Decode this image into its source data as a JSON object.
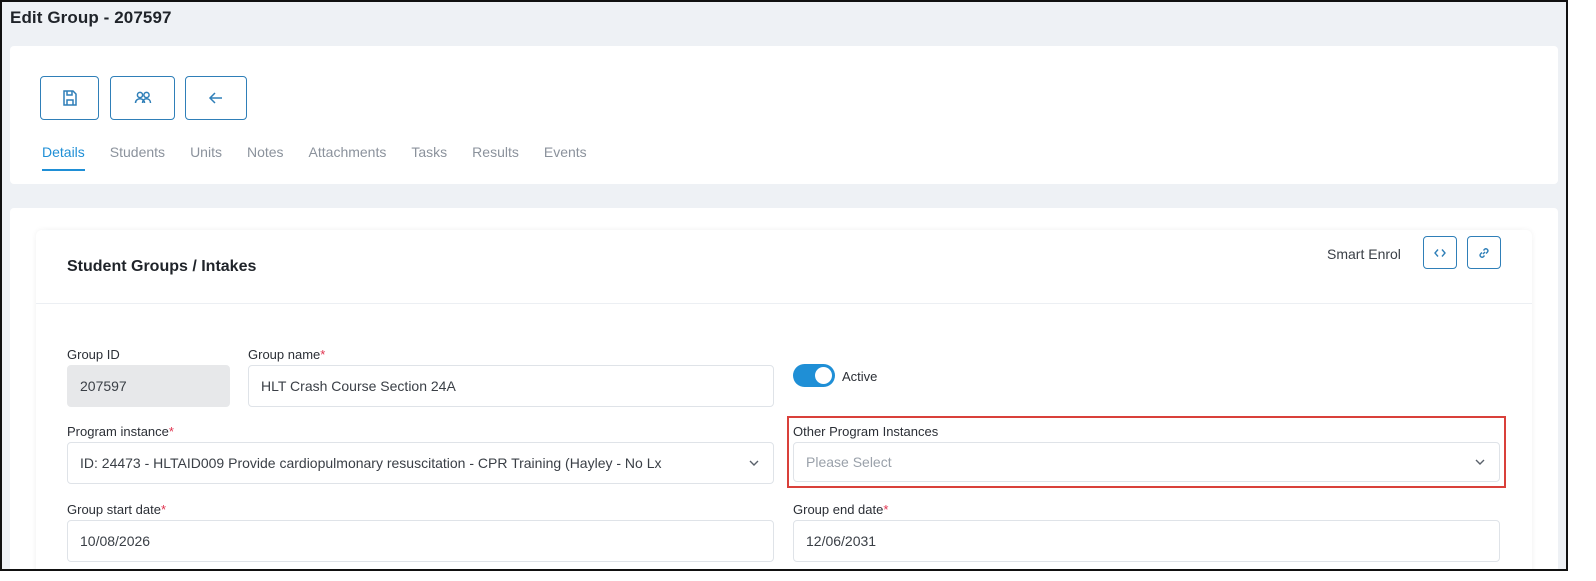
{
  "page": {
    "title": "Edit Group - 207597"
  },
  "toolbar": {
    "save_icon": "save-icon",
    "students_icon": "users-icon",
    "back_icon": "arrow-left-icon"
  },
  "tabs": [
    {
      "label": "Details",
      "active": true
    },
    {
      "label": "Students",
      "active": false
    },
    {
      "label": "Units",
      "active": false
    },
    {
      "label": "Notes",
      "active": false
    },
    {
      "label": "Attachments",
      "active": false
    },
    {
      "label": "Tasks",
      "active": false
    },
    {
      "label": "Results",
      "active": false
    },
    {
      "label": "Events",
      "active": false
    }
  ],
  "card": {
    "title": "Student Groups / Intakes",
    "smart_enrol_label": "Smart Enrol"
  },
  "form": {
    "group_id": {
      "label": "Group ID",
      "value": "207597"
    },
    "group_name": {
      "label": "Group name",
      "required_mark": "*",
      "value": "HLT Crash Course Section 24A"
    },
    "active": {
      "label": "Active",
      "on": true
    },
    "program_instance": {
      "label": "Program instance",
      "required_mark": "*",
      "value": "ID: 24473 - HLTAID009 Provide cardiopulmonary resuscitation - CPR Training (Hayley - No Lx"
    },
    "other_program_instances": {
      "label": "Other Program Instances",
      "placeholder": "Please Select"
    },
    "group_start_date": {
      "label": "Group start date",
      "required_mark": "*",
      "value": "10/08/2026"
    },
    "group_end_date": {
      "label": "Group end date",
      "required_mark": "*",
      "value": "12/06/2031"
    }
  },
  "colors": {
    "accent": "#1f8fd6",
    "button_border": "#2f7fb8",
    "required": "#e0334f",
    "highlight": "#d9403a"
  }
}
